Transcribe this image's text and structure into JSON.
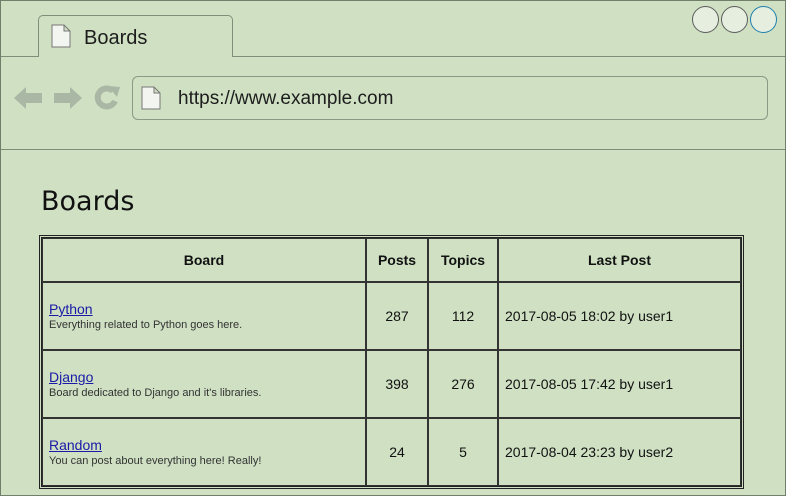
{
  "browser": {
    "tab_title": "Boards",
    "url": "https://www.example.com"
  },
  "page": {
    "title": "Boards"
  },
  "table": {
    "columns": [
      "Board",
      "Posts",
      "Topics",
      "Last Post"
    ],
    "rows": [
      {
        "name": "Python",
        "description": "Everything related to Python goes here.",
        "posts": "287",
        "topics": "112",
        "last_post": "2017-08-05 18:02 by user1"
      },
      {
        "name": "Django",
        "description": "Board dedicated to Django and it's libraries.",
        "posts": "398",
        "topics": "276",
        "last_post": "2017-08-05 17:42 by user1"
      },
      {
        "name": "Random",
        "description": "You can post about everything here! Really!",
        "posts": "24",
        "topics": "5",
        "last_post": "2017-08-04 23:23 by user2"
      }
    ]
  },
  "icons": [
    "page-icon",
    "back-arrow-icon",
    "forward-arrow-icon",
    "reload-icon",
    "window-control-icon"
  ],
  "colors": {
    "background": "#cfe0c3",
    "link": "#1a1aa6"
  }
}
